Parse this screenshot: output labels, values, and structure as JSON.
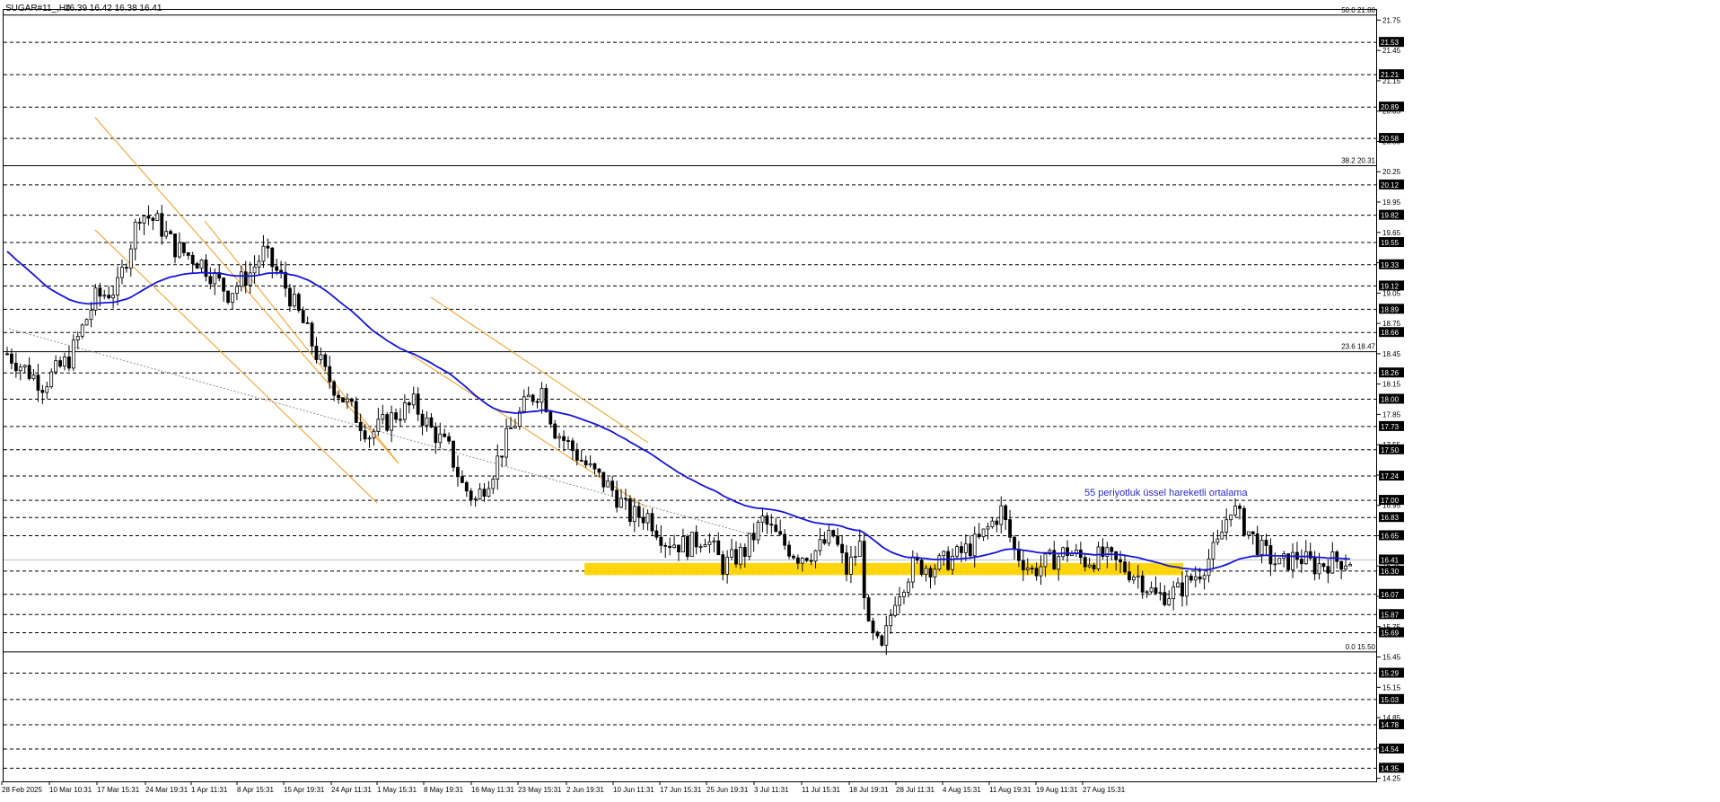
{
  "header": {
    "symbol": "SUGAR#11_,H4",
    "ohlc": "16.39 16.42 16.38 16.41"
  },
  "chart_data": {
    "type": "candlestick",
    "title": "SUGAR#11_,H4",
    "ylim": [
      14.22,
      21.86
    ],
    "price_ticks": [
      "21.75",
      "21.45",
      "21.15",
      "20.85",
      "20.55",
      "20.25",
      "19.95",
      "19.65",
      "19.35",
      "19.05",
      "18.75",
      "18.45",
      "18.15",
      "17.85",
      "17.55",
      "17.25",
      "16.95",
      "16.65",
      "16.35",
      "16.05",
      "15.75",
      "15.45",
      "15.15",
      "14.85",
      "14.55",
      "14.25"
    ],
    "x_labels": [
      "28 Feb 2025",
      "10 Mar 10:31",
      "17 Mar 15:31",
      "24 Mar 19:31",
      "1 Apr 11:31",
      "8 Apr 15:31",
      "15 Apr 19:31",
      "24 Apr 11:31",
      "1 May 15:31",
      "8 May 19:31",
      "16 May 11:31",
      "23 May 15:31",
      "2 Jun 19:31",
      "10 Jun 11:31",
      "17 Jun 15:31",
      "25 Jun 19:31",
      "3 Jul 11:31",
      "11 Jul 15:31",
      "18 Jul 19:31",
      "28 Jul 11:31",
      "4 Aug 15:31",
      "11 Aug 19:31",
      "19 Aug 11:31",
      "27 Aug 15:31"
    ],
    "fibo_levels": [
      {
        "label": "50.0 21.80",
        "value": 21.8
      },
      {
        "label": "38.2 20.31",
        "value": 20.31
      },
      {
        "label": "23.6 18.47",
        "value": 18.47
      },
      {
        "label": "0.0 15.50",
        "value": 15.5
      }
    ],
    "dashed_levels": [
      {
        "label": "21.53",
        "value": 21.53
      },
      {
        "label": "21.21",
        "value": 21.21
      },
      {
        "label": "20.89",
        "value": 20.89
      },
      {
        "label": "20.58",
        "value": 20.58
      },
      {
        "label": "20.12",
        "value": 20.12
      },
      {
        "label": "19.82",
        "value": 19.82
      },
      {
        "label": "19.55",
        "value": 19.55
      },
      {
        "label": "19.33",
        "value": 19.33
      },
      {
        "label": "19.12",
        "value": 19.12
      },
      {
        "label": "18.89",
        "value": 18.89
      },
      {
        "label": "18.66",
        "value": 18.66
      },
      {
        "label": "18.26",
        "value": 18.26
      },
      {
        "label": "18.00",
        "value": 18.0
      },
      {
        "label": "17.73",
        "value": 17.73
      },
      {
        "label": "17.50",
        "value": 17.5
      },
      {
        "label": "17.24",
        "value": 17.24
      },
      {
        "label": "17.00",
        "value": 17.0
      },
      {
        "label": "16.83",
        "value": 16.83
      },
      {
        "label": "16.65",
        "value": 16.65
      },
      {
        "label": "16.30",
        "value": 16.3
      },
      {
        "label": "16.07",
        "value": 16.07
      },
      {
        "label": "15.87",
        "value": 15.87
      },
      {
        "label": "15.69",
        "value": 15.69
      },
      {
        "label": "15.29",
        "value": 15.29
      },
      {
        "label": "15.03",
        "value": 15.03
      },
      {
        "label": "14.78",
        "value": 14.78
      },
      {
        "label": "14.54",
        "value": 14.54
      },
      {
        "label": "14.35",
        "value": 14.35
      }
    ],
    "current_price": {
      "label": "16.41",
      "value": 16.41
    },
    "support_zone": {
      "low": 16.26,
      "high": 16.38
    },
    "ema": {
      "label": "55 periyotluk üssel hareketli ortalama",
      "period": 55
    },
    "close_path": [
      [
        0,
        18.45
      ],
      [
        8,
        18.15
      ],
      [
        14,
        18.4
      ],
      [
        20,
        19.0
      ],
      [
        25,
        19.1
      ],
      [
        30,
        19.85
      ],
      [
        34,
        19.75
      ],
      [
        38,
        19.5
      ],
      [
        44,
        19.35
      ],
      [
        50,
        19.05
      ],
      [
        55,
        19.25
      ],
      [
        58,
        19.45
      ],
      [
        62,
        19.2
      ],
      [
        67,
        18.75
      ],
      [
        72,
        18.25
      ],
      [
        77,
        17.95
      ],
      [
        82,
        17.65
      ],
      [
        88,
        17.85
      ],
      [
        92,
        17.95
      ],
      [
        96,
        17.7
      ],
      [
        100,
        17.5
      ],
      [
        103,
        17.15
      ],
      [
        106,
        17.0
      ],
      [
        110,
        17.3
      ],
      [
        114,
        17.7
      ],
      [
        118,
        18.0
      ],
      [
        121,
        18.1
      ],
      [
        124,
        17.7
      ],
      [
        128,
        17.5
      ],
      [
        132,
        17.3
      ],
      [
        137,
        17.1
      ],
      [
        141,
        16.85
      ],
      [
        145,
        16.85
      ],
      [
        149,
        16.6
      ],
      [
        154,
        16.55
      ],
      [
        158,
        16.65
      ],
      [
        162,
        16.35
      ],
      [
        167,
        16.5
      ],
      [
        171,
        16.8
      ],
      [
        175,
        16.6
      ],
      [
        179,
        16.45
      ],
      [
        183,
        16.5
      ],
      [
        187,
        16.65
      ],
      [
        190,
        16.3
      ],
      [
        193,
        16.55
      ],
      [
        195,
        15.7
      ],
      [
        198,
        15.5
      ],
      [
        201,
        16.05
      ],
      [
        205,
        16.35
      ],
      [
        210,
        16.35
      ],
      [
        215,
        16.45
      ],
      [
        220,
        16.6
      ],
      [
        225,
        16.9
      ],
      [
        228,
        16.5
      ],
      [
        232,
        16.3
      ],
      [
        236,
        16.4
      ],
      [
        240,
        16.5
      ],
      [
        244,
        16.4
      ],
      [
        248,
        16.45
      ],
      [
        252,
        16.35
      ],
      [
        256,
        16.25
      ],
      [
        260,
        16.05
      ],
      [
        265,
        16.1
      ],
      [
        270,
        16.3
      ],
      [
        274,
        16.55
      ],
      [
        277,
        16.95
      ],
      [
        280,
        16.75
      ],
      [
        284,
        16.5
      ],
      [
        288,
        16.35
      ],
      [
        292,
        16.45
      ],
      [
        296,
        16.35
      ],
      [
        300,
        16.4
      ],
      [
        304,
        16.41
      ]
    ],
    "bars_total": 305
  }
}
